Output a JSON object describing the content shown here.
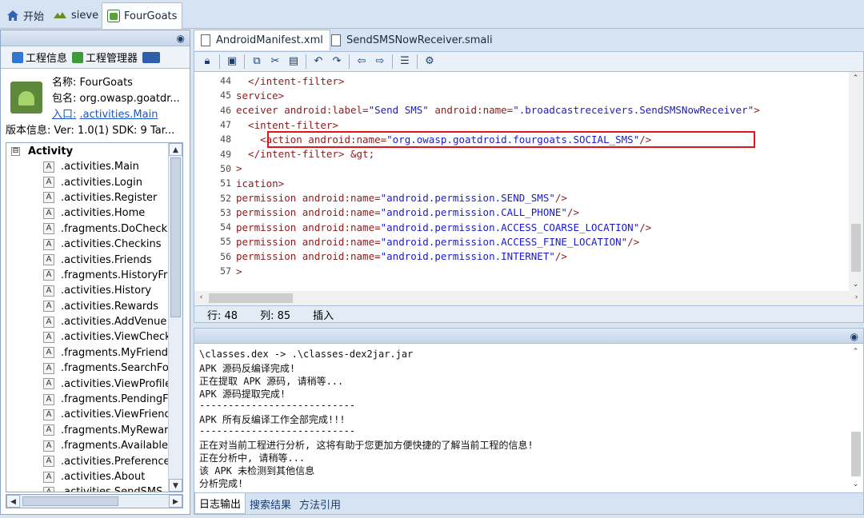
{
  "top_tabs": [
    {
      "label": "开始",
      "icon": "home-icon"
    },
    {
      "label": "sieve",
      "icon": "app-icon"
    },
    {
      "label": "FourGoats",
      "icon": "android-project-icon"
    }
  ],
  "left_panel": {
    "tabs": [
      {
        "label": "工程信息"
      },
      {
        "label": "工程管理器"
      }
    ],
    "info": {
      "name_label": "名称:",
      "name_value": "FourGoats",
      "package_label": "包名:",
      "package_value": "org.owasp.goatdr...",
      "entry_label": "入口:",
      "entry_value": ".activities.Main",
      "version_text": "版本信息: Ver: 1.0(1) SDK: 9 Tar..."
    },
    "tree": {
      "root_label": "Activity",
      "expander": "⊟",
      "items": [
        ".activities.Main",
        ".activities.Login",
        ".activities.Register",
        ".activities.Home",
        ".fragments.DoCheckin",
        ".activities.Checkins",
        ".activities.Friends",
        ".fragments.HistoryFra",
        ".activities.History",
        ".activities.Rewards",
        ".activities.AddVenue",
        ".activities.ViewCheckin",
        ".fragments.MyFriends",
        ".fragments.SearchFor",
        ".activities.ViewProfile",
        ".fragments.PendingFr",
        ".activities.ViewFriendR",
        ".fragments.MyRewards",
        ".fragments.AvailableR",
        ".activities.Preferences",
        ".activities.About",
        ".activities.SendSMS"
      ]
    }
  },
  "editor": {
    "tabs": [
      {
        "label": "AndroidManifest.xml",
        "active": true
      },
      {
        "label": "SendSMSNowReceiver.smali",
        "active": false
      }
    ],
    "lines": [
      {
        "num": "44",
        "text": "  </intent-filter>"
      },
      {
        "num": "45",
        "text": "service>"
      },
      {
        "num": "46",
        "text": "eceiver android:label=\"Send SMS\" android:name=\".broadcastreceivers.SendSMSNowReceiver\">"
      },
      {
        "num": "47",
        "text": "  <intent-filter>"
      },
      {
        "num": "48",
        "text": "    <action android:name=\"org.owasp.goatdroid.fourgoats.SOCIAL_SMS\"/>"
      },
      {
        "num": "49",
        "text": "  </intent-filter> &gt;"
      },
      {
        "num": "50",
        "text": ">"
      },
      {
        "num": "51",
        "text": "ication>"
      },
      {
        "num": "52",
        "text": "permission android:name=\"android.permission.SEND_SMS\"/>"
      },
      {
        "num": "53",
        "text": "permission android:name=\"android.permission.CALL_PHONE\"/>"
      },
      {
        "num": "54",
        "text": "permission android:name=\"android.permission.ACCESS_COARSE_LOCATION\"/>"
      },
      {
        "num": "55",
        "text": "permission android:name=\"android.permission.ACCESS_FINE_LOCATION\"/>"
      },
      {
        "num": "56",
        "text": "permission android:name=\"android.permission.INTERNET\"/>"
      },
      {
        "num": "57",
        "text": ">"
      }
    ],
    "status": {
      "row": "行: 48",
      "col": "列: 85",
      "mode": "插入"
    },
    "highlight_color": "#e0161b"
  },
  "log": {
    "lines": [
      "\\classes.dex -> .\\classes-dex2jar.jar",
      "APK 源码反编译完成!",
      "正在提取 APK 源码, 请稍等...",
      "APK 源码提取完成!",
      "---------------------------",
      "APK 所有反编译工作全部完成!!!",
      "---------------------------",
      "正在对当前工程进行分析, 这将有助于您更加方便快捷的了解当前工程的信息!",
      "正在分析中, 请稍等...",
      "该 APK 未检测到其他信息",
      "分析完成!"
    ],
    "tabs": [
      {
        "label": "日志输出",
        "active": true
      },
      {
        "label": "搜索结果",
        "active": false
      },
      {
        "label": "方法引用",
        "active": false
      }
    ]
  }
}
